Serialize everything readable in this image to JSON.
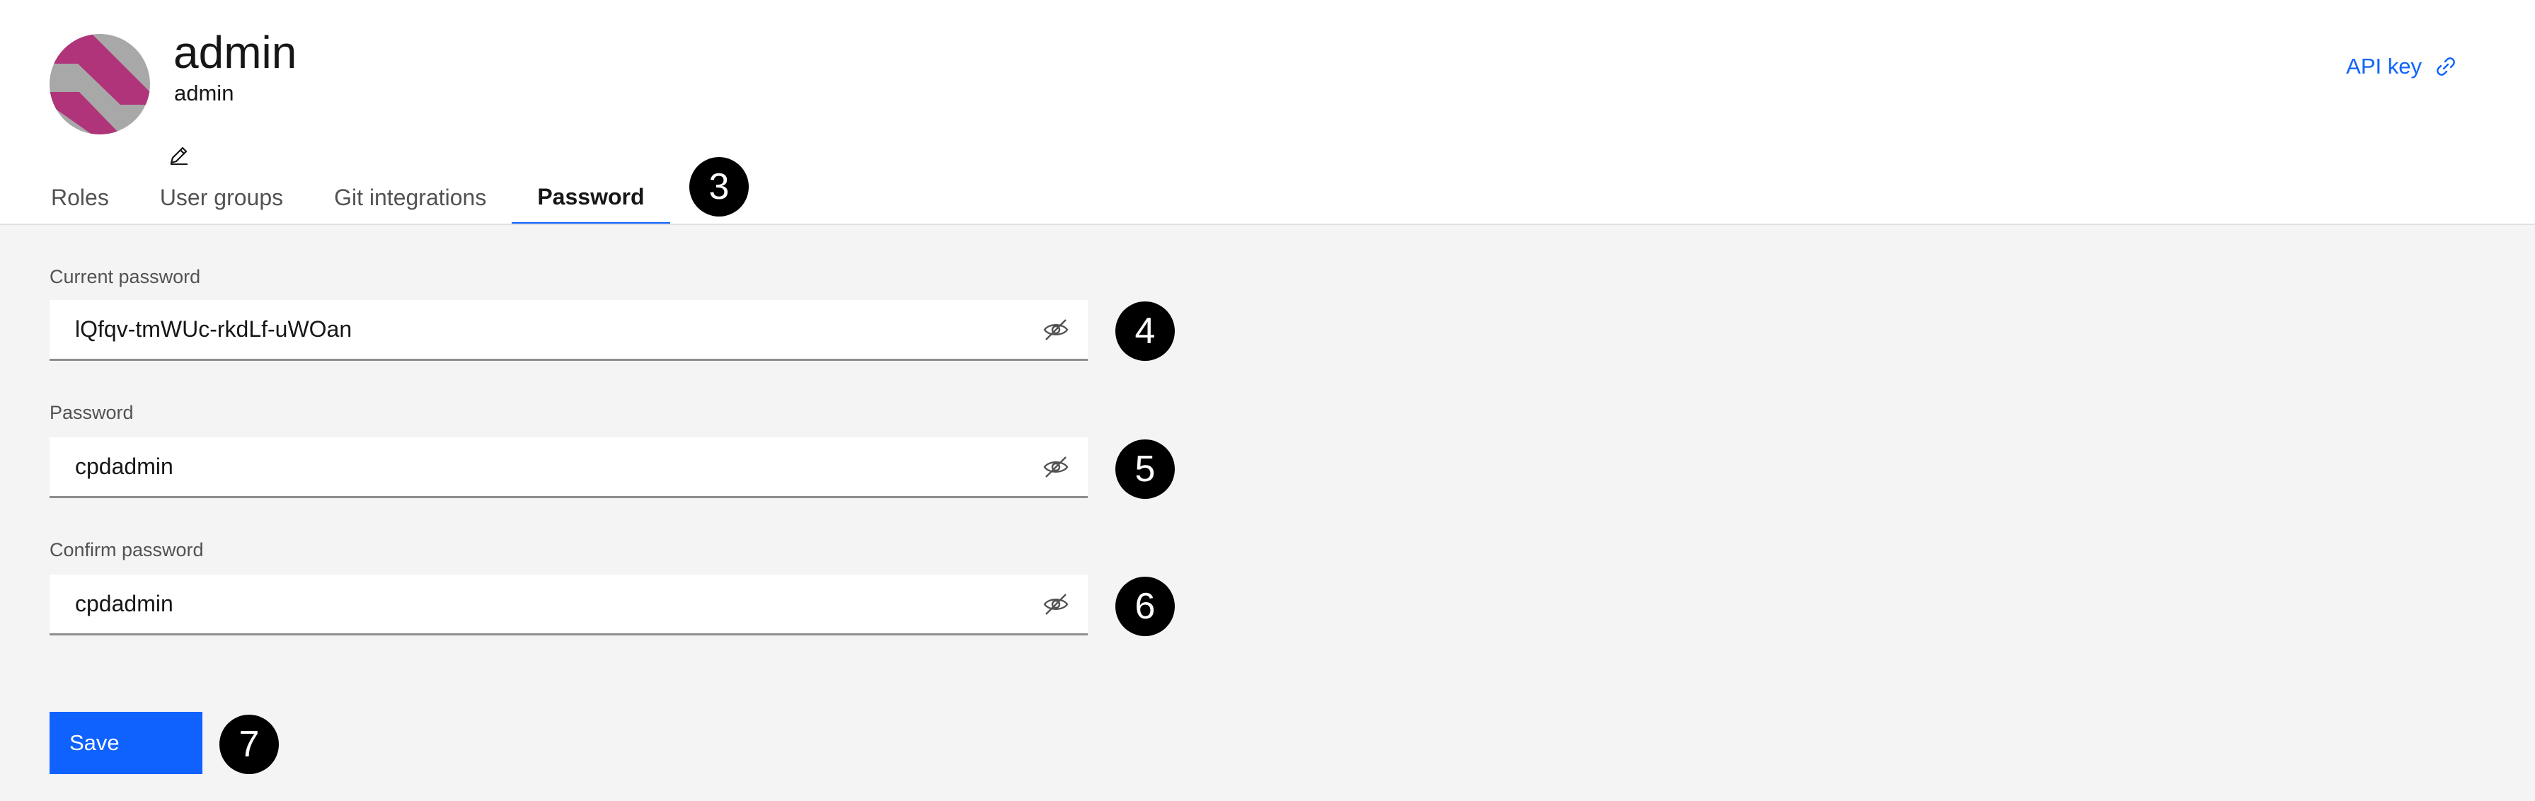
{
  "user": {
    "name": "admin",
    "username": "admin"
  },
  "api_key": {
    "label": "API key",
    "icon": "link-icon"
  },
  "tabs": [
    {
      "label": "Roles",
      "active": false
    },
    {
      "label": "User groups",
      "active": false
    },
    {
      "label": "Git integrations",
      "active": false
    },
    {
      "label": "Password",
      "active": true
    }
  ],
  "form": {
    "current_password": {
      "label": "Current password",
      "value": "lQfqv-tmWUc-rkdLf-uWOan"
    },
    "password": {
      "label": "Password",
      "value": "cpdadmin"
    },
    "confirm_password": {
      "label": "Confirm password",
      "value": "cpdadmin"
    },
    "save_label": "Save"
  },
  "callouts": [
    "3",
    "4",
    "5",
    "6",
    "7"
  ],
  "colors": {
    "accent": "#0f62fe",
    "avatar_primary": "#b0347a",
    "avatar_secondary": "#a8a8a8",
    "background": "#f4f4f4"
  }
}
